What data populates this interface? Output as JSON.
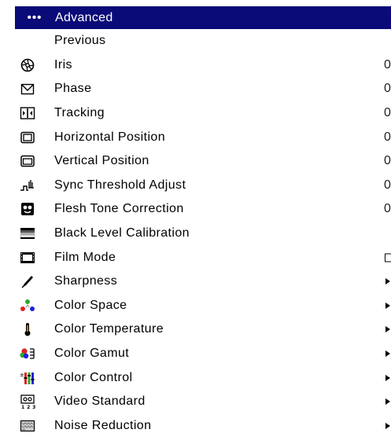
{
  "header": {
    "dots": "•••",
    "title": "Advanced"
  },
  "items": [
    {
      "label": "Previous",
      "icon": "none",
      "control": "none",
      "value": ""
    },
    {
      "label": "Iris",
      "icon": "iris-icon",
      "control": "value",
      "value": "0"
    },
    {
      "label": "Phase",
      "icon": "phase-icon",
      "control": "value",
      "value": "0"
    },
    {
      "label": "Tracking",
      "icon": "tracking-icon",
      "control": "value",
      "value": "0"
    },
    {
      "label": "Horizontal Position",
      "icon": "horizontal-position-icon",
      "control": "value",
      "value": "0"
    },
    {
      "label": "Vertical Position",
      "icon": "vertical-position-icon",
      "control": "value",
      "value": "0"
    },
    {
      "label": "Sync Threshold Adjust",
      "icon": "sync-threshold-icon",
      "control": "value",
      "value": "0"
    },
    {
      "label": "Flesh Tone Correction",
      "icon": "flesh-tone-icon",
      "control": "value",
      "value": "0"
    },
    {
      "label": "Black Level Calibration",
      "icon": "black-level-icon",
      "control": "none",
      "value": ""
    },
    {
      "label": "Film Mode",
      "icon": "film-mode-icon",
      "control": "checkbox",
      "value": ""
    },
    {
      "label": "Sharpness",
      "icon": "sharpness-icon",
      "control": "arrow",
      "value": ""
    },
    {
      "label": "Color Space",
      "icon": "color-space-icon",
      "control": "arrow",
      "value": ""
    },
    {
      "label": "Color Temperature",
      "icon": "color-temperature-icon",
      "control": "arrow",
      "value": ""
    },
    {
      "label": "Color Gamut",
      "icon": "color-gamut-icon",
      "control": "arrow",
      "value": ""
    },
    {
      "label": "Color Control",
      "icon": "color-control-icon",
      "control": "arrow",
      "value": ""
    },
    {
      "label": "Video Standard",
      "icon": "video-standard-icon",
      "control": "arrow",
      "value": ""
    },
    {
      "label": "Noise Reduction",
      "icon": "noise-reduction-icon",
      "control": "arrow",
      "value": ""
    }
  ],
  "colors": {
    "header_bg": "#0a0a78",
    "header_text": "#ffffff"
  }
}
